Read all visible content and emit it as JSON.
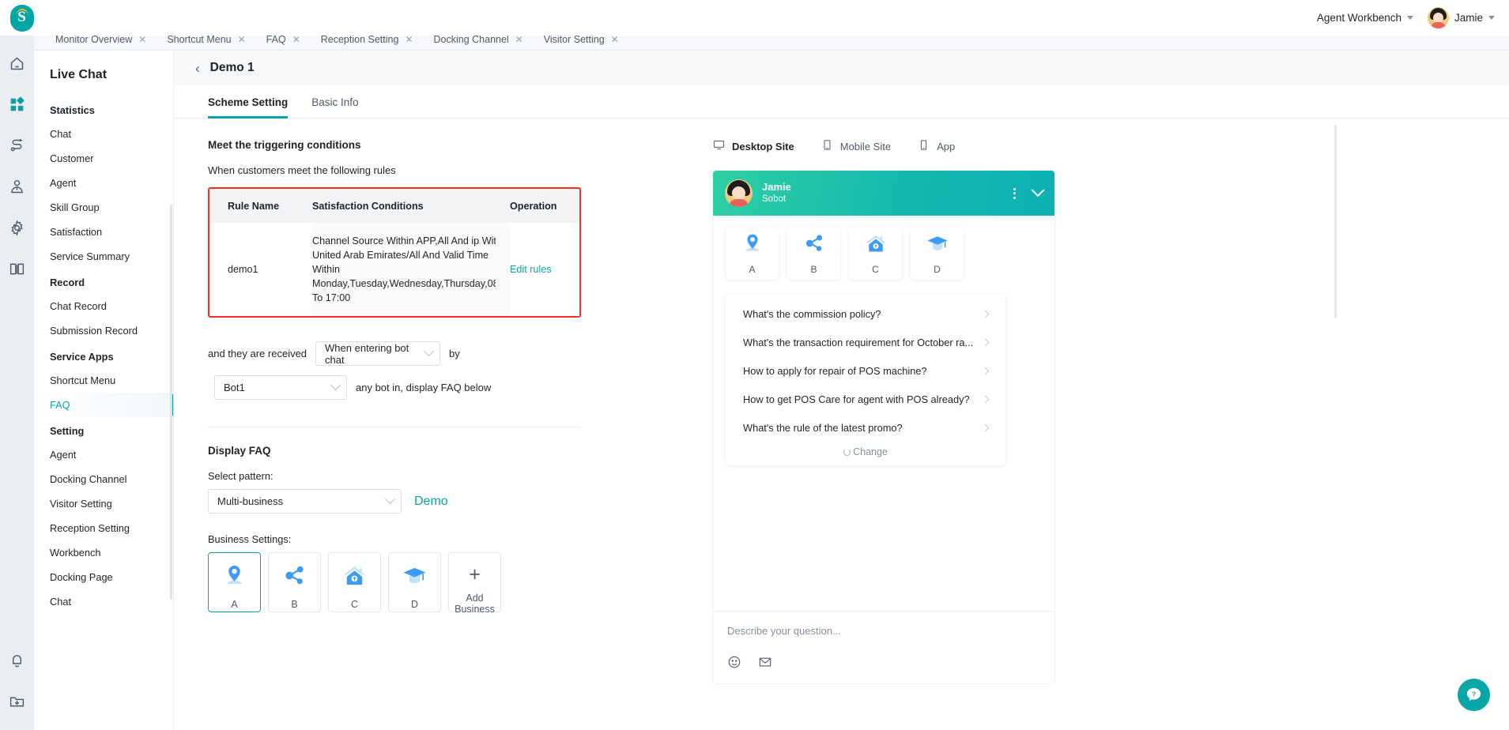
{
  "topbar": {
    "logo_letter": "S",
    "workbench_label": "Agent Workbench",
    "user_name": "Jamie"
  },
  "tabstrip": {
    "tabs": [
      {
        "label": "Monitor Overview"
      },
      {
        "label": "Shortcut Menu"
      },
      {
        "label": "FAQ"
      },
      {
        "label": "Reception Setting"
      },
      {
        "label": "Docking Channel"
      },
      {
        "label": "Visitor Setting"
      }
    ],
    "close_glyph": "✕"
  },
  "rail": {
    "icons": [
      "home-icon",
      "apps-icon",
      "flow-icon",
      "agent-icon",
      "gear-icon",
      "book-icon"
    ],
    "bottom_icons": [
      "bell-icon",
      "download-icon"
    ]
  },
  "sidebar": {
    "title": "Live Chat",
    "sections": [
      {
        "group": "Statistics",
        "items": [
          {
            "label": "Chat",
            "active": false
          },
          {
            "label": "Customer",
            "active": false
          },
          {
            "label": "Agent",
            "active": false
          },
          {
            "label": "Skill Group",
            "active": false
          },
          {
            "label": "Satisfaction",
            "active": false
          },
          {
            "label": "Service Summary",
            "active": false
          }
        ]
      },
      {
        "group": "Record",
        "items": [
          {
            "label": "Chat Record",
            "active": false
          },
          {
            "label": "Submission Record",
            "active": false
          }
        ]
      },
      {
        "group": "Service Apps",
        "items": [
          {
            "label": "Shortcut Menu",
            "active": false
          },
          {
            "label": "FAQ",
            "active": true
          }
        ]
      },
      {
        "group": "Setting",
        "items": [
          {
            "label": "Agent",
            "active": false
          },
          {
            "label": "Docking Channel",
            "active": false
          },
          {
            "label": "Visitor Setting",
            "active": false
          },
          {
            "label": "Reception Setting",
            "active": false
          },
          {
            "label": "Workbench",
            "active": false
          },
          {
            "label": "Docking Page",
            "active": false
          },
          {
            "label": "Chat",
            "active": false
          }
        ]
      }
    ]
  },
  "page": {
    "back_glyph": "‹",
    "title": "Demo 1",
    "tabs": [
      {
        "label": "Scheme Setting",
        "active": true
      },
      {
        "label": "Basic Info",
        "active": false
      }
    ]
  },
  "trigger": {
    "section_title": "Meet the triggering conditions",
    "subtitle": "When customers meet the following rules",
    "table": {
      "headers": [
        "Rule Name",
        "Satisfaction Conditions",
        "Operation"
      ],
      "rows": [
        {
          "rule_name": "demo1",
          "conditions_lines": [
            "Channel Source Within APP,All And ip Wit",
            "United Arab Emirates/All And Valid Time",
            "Within",
            "Monday,Tuesday,Wednesday,Thursday,08",
            "To 17:00"
          ],
          "operation": "Edit rules"
        }
      ]
    },
    "received_prefix": "and they are received",
    "received_value": "When entering bot chat",
    "received_by": "by",
    "bot_value": "Bot1",
    "bot_suffix": "any bot in, display FAQ below"
  },
  "display_faq": {
    "section_title": "Display FAQ",
    "select_pattern_label": "Select pattern:",
    "pattern_value": "Multi-business",
    "demo_link": "Demo",
    "business_label": "Business Settings:",
    "businesses": [
      {
        "caption": "A",
        "icon": "location-pin-icon",
        "selected": true
      },
      {
        "caption": "B",
        "icon": "share-nodes-icon",
        "selected": false
      },
      {
        "caption": "C",
        "icon": "house-money-icon",
        "selected": false
      },
      {
        "caption": "D",
        "icon": "graduation-cap-icon",
        "selected": false
      }
    ],
    "add_business_label": "Add Business",
    "add_glyph": "+"
  },
  "preview": {
    "device_tabs": [
      {
        "label": "Desktop Site",
        "icon": "desktop-icon",
        "active": true
      },
      {
        "label": "Mobile Site",
        "icon": "mobile-icon",
        "active": false
      },
      {
        "label": "App",
        "icon": "app-icon",
        "active": false
      }
    ],
    "widget": {
      "agent_name": "Jamie",
      "agent_sub": "Sobot",
      "businesses": [
        {
          "caption": "A",
          "icon": "location-pin-icon"
        },
        {
          "caption": "B",
          "icon": "share-nodes-icon"
        },
        {
          "caption": "C",
          "icon": "house-money-icon"
        },
        {
          "caption": "D",
          "icon": "graduation-cap-icon"
        }
      ],
      "faq_items": [
        "What's the commission policy?",
        "What's the transaction requirement for October ra...",
        "How to apply for repair of POS machine?",
        "How to get POS Care for agent with POS already?",
        "What's the rule of the latest promo?"
      ],
      "change_label": "Change",
      "input_placeholder": "Describe your question...",
      "foot_icons": [
        "emoji-icon",
        "mail-icon"
      ]
    }
  },
  "help": {
    "glyph": "?"
  },
  "colors": {
    "accent": "#0aa5a8",
    "widget_header_start": "#2ecfa4",
    "widget_header_end": "#0cb0b3",
    "highlight_border": "#ff2d20",
    "biz_blue": "#3d9bf5"
  }
}
